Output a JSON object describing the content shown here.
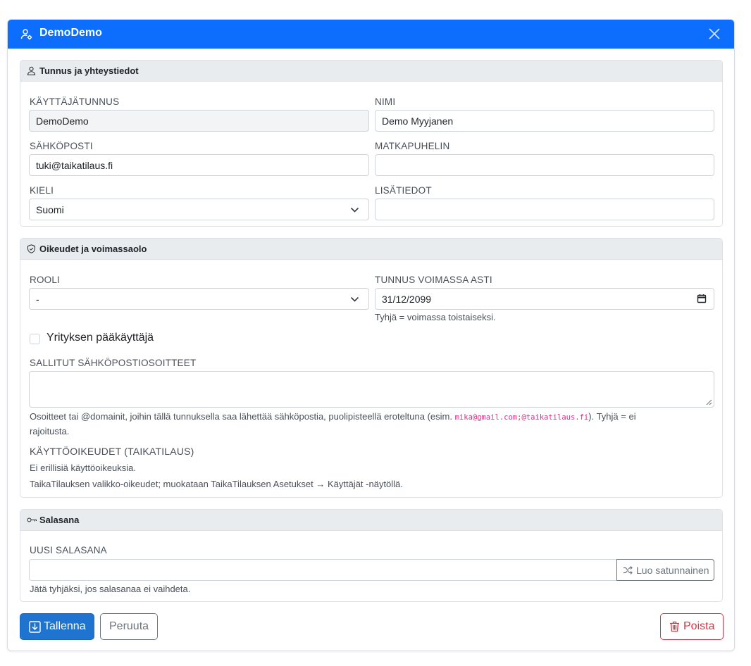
{
  "dialog": {
    "title": "DemoDemo",
    "header_color": "#0d6efd"
  },
  "section_contact": {
    "title": "Tunnus ja yhteystiedot",
    "username_label": "KÄYTTÄJÄTUNNUS",
    "username_value": "DemoDemo",
    "name_label": "NIMI",
    "name_value": "Demo Myyjanen",
    "email_label": "SÄHKÖPOSTI",
    "email_value": "tuki@taikatilaus.fi",
    "mobile_label": "MATKAPUHELIN",
    "mobile_value": "",
    "language_label": "KIELI",
    "language_value": "Suomi",
    "extra_label": "LISÄTIEDOT",
    "extra_value": ""
  },
  "section_rights": {
    "title": "Oikeudet ja voimassaolo",
    "role_label": "ROOLI",
    "role_value": "-",
    "valid_label": "TUNNUS VOIMASSA ASTI",
    "valid_value": "31/12/2099",
    "valid_hint": "Tyhjä = voimassa toistaiseksi.",
    "admin_checkbox_label": "Yrityksen pääkäyttäjä",
    "allowed_label": "SALLITUT SÄHKÖPOSTIOSOITTEET",
    "allowed_value": "",
    "allowed_hint_before": "Osoitteet tai @domainit, joihin tällä tunnuksella saa lähettää sähköpostia, puolipisteellä eroteltuna (esim. ",
    "allowed_hint_code": "mika@gmail.com;@taikatilaus.fi",
    "allowed_hint_after": "). Tyhjä = ei",
    "allowed_hint_line2": "rajoitusta.",
    "permissions_label": "KÄYTTÖOIKEUDET (TAIKATILAUS)",
    "permissions_none": "Ei erillisiä käyttöoikeuksia.",
    "permissions_note": "TaikaTilauksen valikko-oikeudet; muokataan TaikaTilauksen Asetukset → Käyttäjät -näytöllä."
  },
  "section_password": {
    "title": "Salasana",
    "new_label": "UUSI SALASANA",
    "new_value": "",
    "random_button": "Luo satunnainen",
    "hint": "Jätä tyhjäksi, jos salasanaa ei vaihdeta."
  },
  "footer": {
    "save_label": "Tallenna",
    "cancel_label": "Peruuta",
    "delete_label": "Poista"
  }
}
